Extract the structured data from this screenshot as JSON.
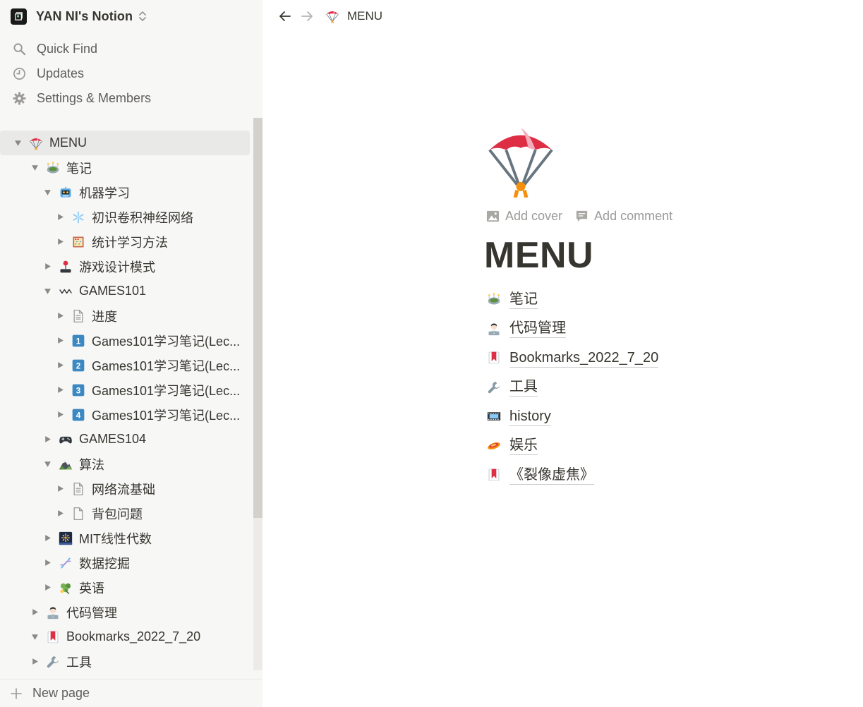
{
  "app": {
    "workspace_name": "YAN NI's Notion"
  },
  "sidebar": {
    "nav": [
      {
        "label": "Quick Find",
        "icon": "search-icon"
      },
      {
        "label": "Updates",
        "icon": "clock-icon"
      },
      {
        "label": "Settings & Members",
        "icon": "gear-icon"
      }
    ],
    "tree": [
      {
        "label": "MENU",
        "level": 0,
        "state": "expanded",
        "icon": "parachute-icon",
        "active": true
      },
      {
        "label": "笔记",
        "level": 1,
        "state": "expanded",
        "icon": "stadium-icon"
      },
      {
        "label": "机器学习",
        "level": 2,
        "state": "expanded",
        "icon": "robot-icon"
      },
      {
        "label": "初识卷积神经网络",
        "level": 3,
        "state": "collapsed",
        "icon": "snowflake-icon"
      },
      {
        "label": "统计学习方法",
        "level": 3,
        "state": "collapsed",
        "icon": "abacus-icon"
      },
      {
        "label": "游戏设计模式",
        "level": 2,
        "state": "collapsed",
        "icon": "joystick-icon"
      },
      {
        "label": "GAMES101",
        "level": 2,
        "state": "expanded",
        "icon": "wave-icon"
      },
      {
        "label": "进度",
        "level": 3,
        "state": "collapsed",
        "icon": "page-icon"
      },
      {
        "label": "Games101学习笔记(Lec...",
        "level": 3,
        "state": "collapsed",
        "icon": "keycap-1-icon"
      },
      {
        "label": "Games101学习笔记(Lec...",
        "level": 3,
        "state": "collapsed",
        "icon": "keycap-2-icon"
      },
      {
        "label": "Games101学习笔记(Lec...",
        "level": 3,
        "state": "collapsed",
        "icon": "keycap-3-icon"
      },
      {
        "label": "Games101学习笔记(Lec...",
        "level": 3,
        "state": "collapsed",
        "icon": "keycap-4-icon"
      },
      {
        "label": "GAMES104",
        "level": 2,
        "state": "collapsed",
        "icon": "gamepad-icon"
      },
      {
        "label": "算法",
        "level": 2,
        "state": "expanded",
        "icon": "mountain-icon"
      },
      {
        "label": "网络流基础",
        "level": 3,
        "state": "collapsed",
        "icon": "page-icon"
      },
      {
        "label": "背包问题",
        "level": 3,
        "state": "collapsed",
        "icon": "blank-page-icon"
      },
      {
        "label": "MIT线性代数",
        "level": 2,
        "state": "collapsed",
        "icon": "fireworks-icon"
      },
      {
        "label": "数据挖掘",
        "level": 2,
        "state": "collapsed",
        "icon": "dna-icon"
      },
      {
        "label": "英语",
        "level": 2,
        "state": "collapsed",
        "icon": "shamrock-icon"
      },
      {
        "label": "代码管理",
        "level": 1,
        "state": "collapsed",
        "icon": "technologist-icon"
      },
      {
        "label": "Bookmarks_2022_7_20",
        "level": 1,
        "state": "expanded",
        "icon": "bookmark-icon"
      },
      {
        "label": "工具",
        "level": 1,
        "state": "collapsed",
        "icon": "wrench-icon"
      }
    ],
    "new_page_label": "New page"
  },
  "topbar": {
    "breadcrumb": "MENU"
  },
  "page": {
    "title": "MENU",
    "add_cover": "Add cover",
    "add_comment": "Add comment",
    "links": [
      {
        "label": "笔记",
        "icon": "stadium-icon"
      },
      {
        "label": "代码管理",
        "icon": "technologist-icon"
      },
      {
        "label": "Bookmarks_2022_7_20",
        "icon": "bookmark-icon"
      },
      {
        "label": "工具",
        "icon": "wrench-icon"
      },
      {
        "label": "history",
        "icon": "film-icon"
      },
      {
        "label": "娱乐",
        "icon": "flying-disc-icon"
      },
      {
        "label": "《裂像虚焦》",
        "icon": "bookmark-icon"
      }
    ]
  },
  "colors": {
    "sidebar_bg": "#f7f7f5",
    "text": "#37352f",
    "muted": "#9b9a97",
    "active_row": "#e9e9e7"
  }
}
